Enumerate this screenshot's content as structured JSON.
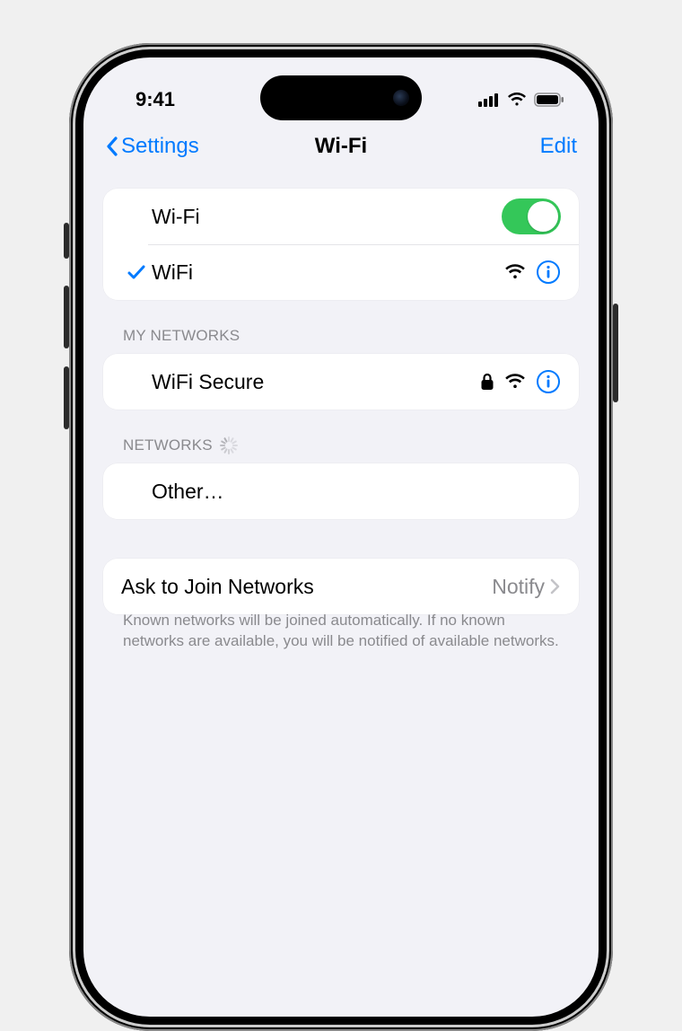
{
  "status": {
    "time": "9:41"
  },
  "nav": {
    "back": "Settings",
    "title": "Wi-Fi",
    "edit": "Edit"
  },
  "wifi": {
    "toggle_label": "Wi-Fi",
    "toggle_on": true,
    "connected_name": "WiFi"
  },
  "sections": {
    "my_networks_header": "MY NETWORKS",
    "networks_header": "NETWORKS"
  },
  "my_networks": [
    {
      "name": "WiFi Secure",
      "secure": true
    }
  ],
  "other_label": "Other…",
  "ask_to_join": {
    "label": "Ask to Join Networks",
    "value": "Notify"
  },
  "footer": "Known networks will be joined automatically. If no known networks are available, you will be notified of available networks.",
  "colors": {
    "tint": "#007aff",
    "toggle_on": "#34c759"
  }
}
